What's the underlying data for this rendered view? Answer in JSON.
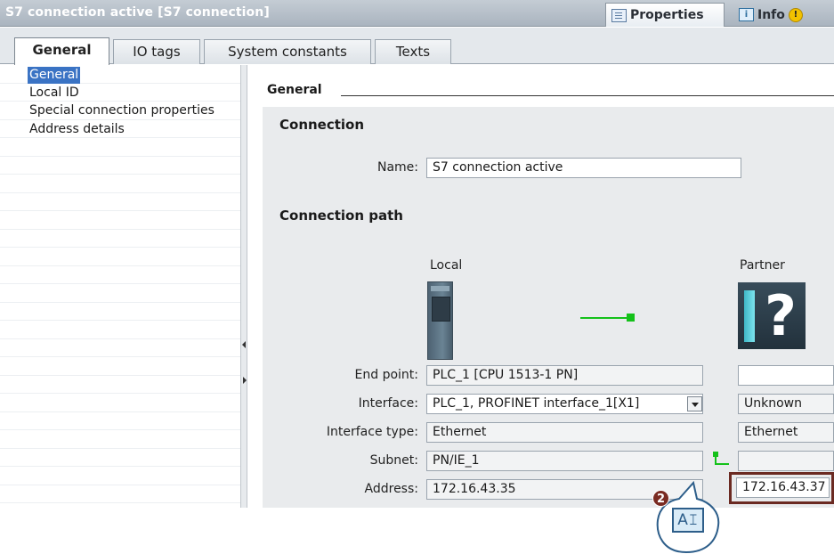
{
  "window": {
    "title": "S7 connection active [S7 connection]",
    "panel_tabs": [
      {
        "label": "Properties",
        "icon": "properties-icon"
      },
      {
        "label": "Info",
        "icon": "info-icon"
      }
    ]
  },
  "tabs": [
    {
      "label": "General",
      "active": true
    },
    {
      "label": "IO tags"
    },
    {
      "label": "System constants"
    },
    {
      "label": "Texts"
    }
  ],
  "nav": [
    {
      "label": "General",
      "selected": true
    },
    {
      "label": "Local ID"
    },
    {
      "label": "Special connection properties"
    },
    {
      "label": "Address details"
    }
  ],
  "content": {
    "section_title": "General",
    "connection": {
      "heading": "Connection",
      "name_label": "Name:",
      "name_value": "S7 connection active"
    },
    "path": {
      "heading": "Connection path",
      "local_label": "Local",
      "partner_label": "Partner",
      "rows": {
        "end_point": {
          "label": "End point:",
          "local": "PLC_1 [CPU 1513-1 PN]",
          "partner": ""
        },
        "interface": {
          "label": "Interface:",
          "local": "PLC_1, PROFINET interface_1[X1]",
          "partner": "Unknown"
        },
        "interface_type": {
          "label": "Interface type:",
          "local": "Ethernet",
          "partner": "Ethernet"
        },
        "subnet": {
          "label": "Subnet:",
          "local": "PN/IE_1",
          "partner": ""
        },
        "address": {
          "label": "Address:",
          "local": "172.16.43.35",
          "partner": "172.16.43.37"
        }
      }
    }
  },
  "callout": {
    "step": "2",
    "button_text": "A𝙸"
  },
  "colors": {
    "highlight_border": "#6b2a22",
    "selection": "#3a73c4",
    "connection_green": "#14c11a",
    "badge": "#7a2b22"
  }
}
